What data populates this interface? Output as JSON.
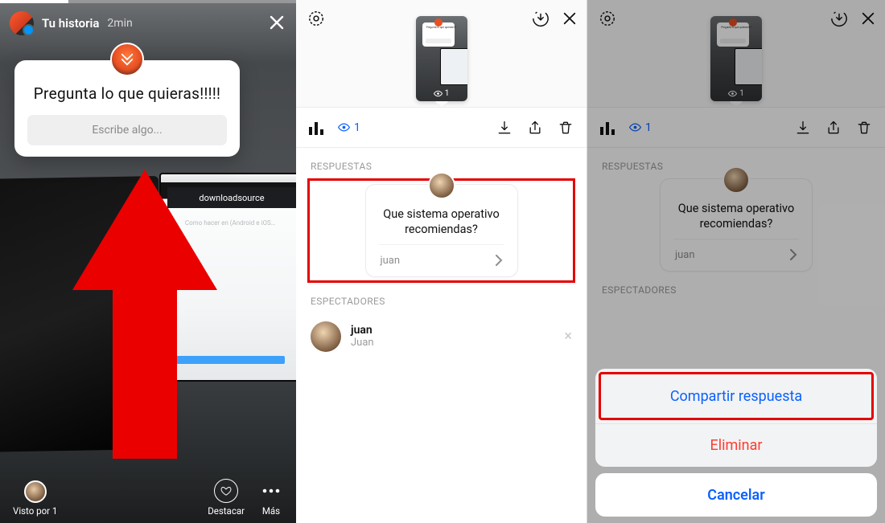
{
  "story": {
    "title": "Tu historia",
    "time": "2min",
    "question": "Pregunta lo que quieras!!!!!",
    "placeholder": "Escribe algo...",
    "viewed_by": "Visto por 1",
    "highlight": "Destacar",
    "more": "Más",
    "bg_banner": "downloadsource",
    "bg_subtitle": "Como hacer en (Android e iOS…"
  },
  "viewer": {
    "thumb_mini_text": "Pregunta lo que quieras!!!!!",
    "views_count": "1",
    "views_label": "1",
    "responses_label": "RESPUESTAS",
    "answer_text": "Que sistema operativo recomiendas?",
    "answer_user": "juan",
    "spectators_label": "ESPECTADORES",
    "spectator_username": "juan",
    "spectator_name": "Juan"
  },
  "sheet": {
    "share": "Compartir respuesta",
    "delete": "Eliminar",
    "cancel": "Cancelar"
  }
}
